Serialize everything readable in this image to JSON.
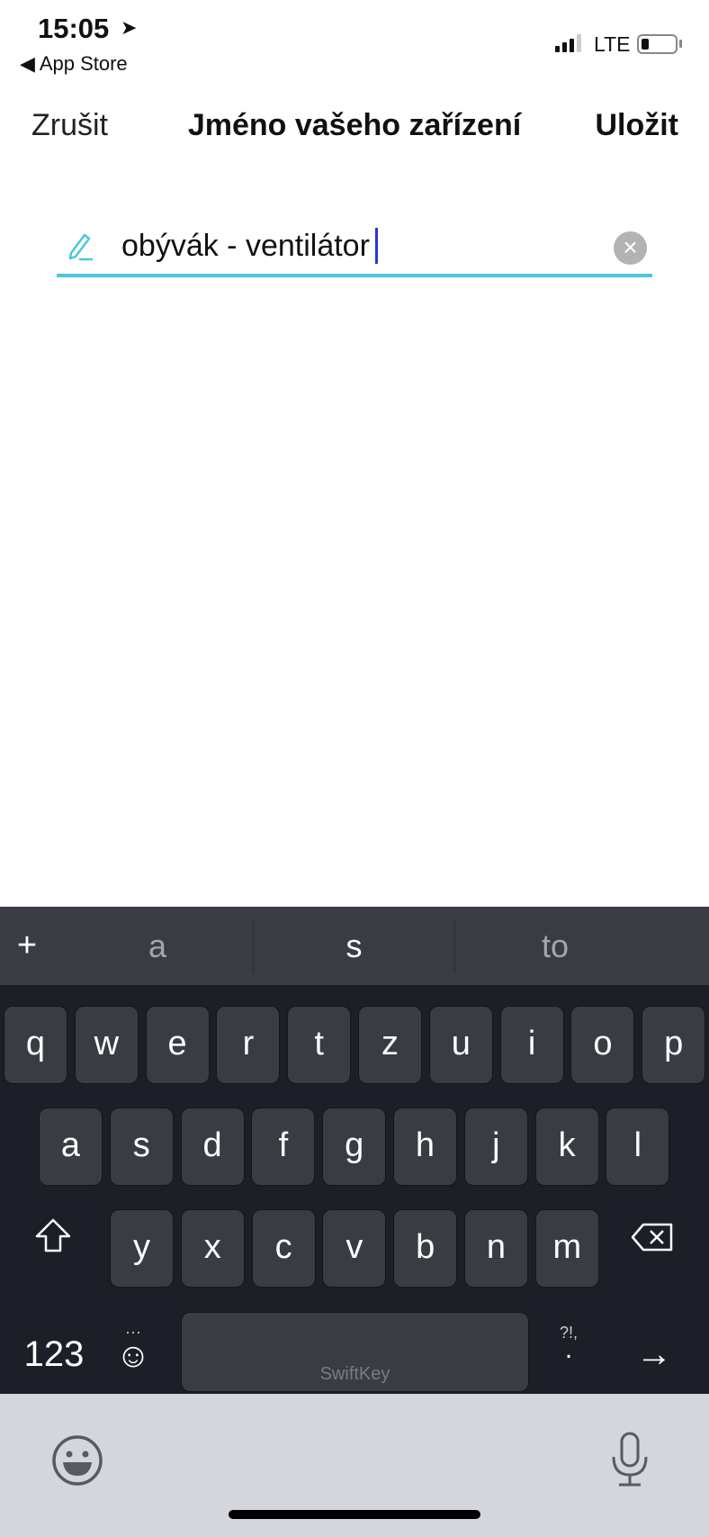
{
  "status_bar": {
    "time": "15:05",
    "back_label": "◀ App Store",
    "network": "LTE",
    "location_icon": "location-arrow-icon",
    "battery_level": 0.15
  },
  "nav": {
    "cancel": "Zrušit",
    "title": "Jméno vašeho zařízení",
    "save": "Uložit"
  },
  "field": {
    "value": "obývák - ventilátor",
    "icon": "pencil-icon",
    "accent": "#4ec6dc"
  },
  "keyboard": {
    "suggestions": [
      "a",
      "s",
      "to"
    ],
    "add_label": "+",
    "rows": [
      [
        "q",
        "w",
        "e",
        "r",
        "t",
        "z",
        "u",
        "i",
        "o",
        "p"
      ],
      [
        "a",
        "s",
        "d",
        "f",
        "g",
        "h",
        "j",
        "k",
        "l"
      ],
      [
        "y",
        "x",
        "c",
        "v",
        "b",
        "n",
        "m"
      ]
    ],
    "numbers_label": "123",
    "space_brand": "SwiftKey",
    "punct_label": "?!,",
    "punct_dot": "."
  }
}
